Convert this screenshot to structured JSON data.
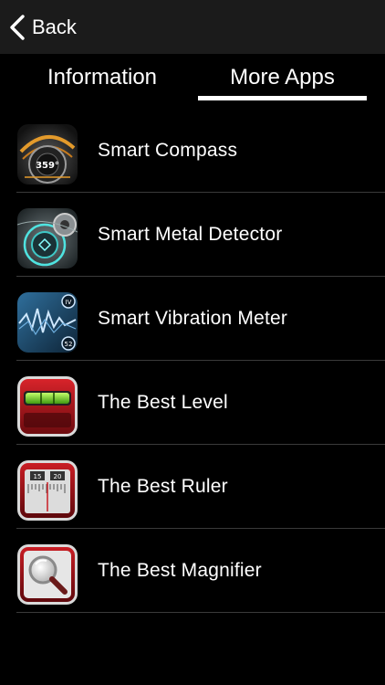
{
  "nav": {
    "back_label": "Back"
  },
  "tabs": [
    {
      "label": "Information",
      "selected": false
    },
    {
      "label": "More Apps",
      "selected": true
    }
  ],
  "apps": [
    {
      "title": "Smart Compass",
      "icon": "compass-app-icon",
      "icon_text": "359°"
    },
    {
      "title": "Smart Metal Detector",
      "icon": "metal-detector-app-icon"
    },
    {
      "title": "Smart Vibration Meter",
      "icon": "vibration-meter-app-icon",
      "icon_text_top": "IV",
      "icon_text_bottom": "52"
    },
    {
      "title": "The Best Level",
      "icon": "level-app-icon"
    },
    {
      "title": "The Best Ruler",
      "icon": "ruler-app-icon",
      "icon_text_left": "15",
      "icon_text_right": "20"
    },
    {
      "title": "The Best Magnifier",
      "icon": "magnifier-app-icon"
    }
  ],
  "colors": {
    "navbar_bg": "#1b1b1b",
    "background": "#000000",
    "separator": "#3a3a3a",
    "accent": "#ffffff"
  }
}
